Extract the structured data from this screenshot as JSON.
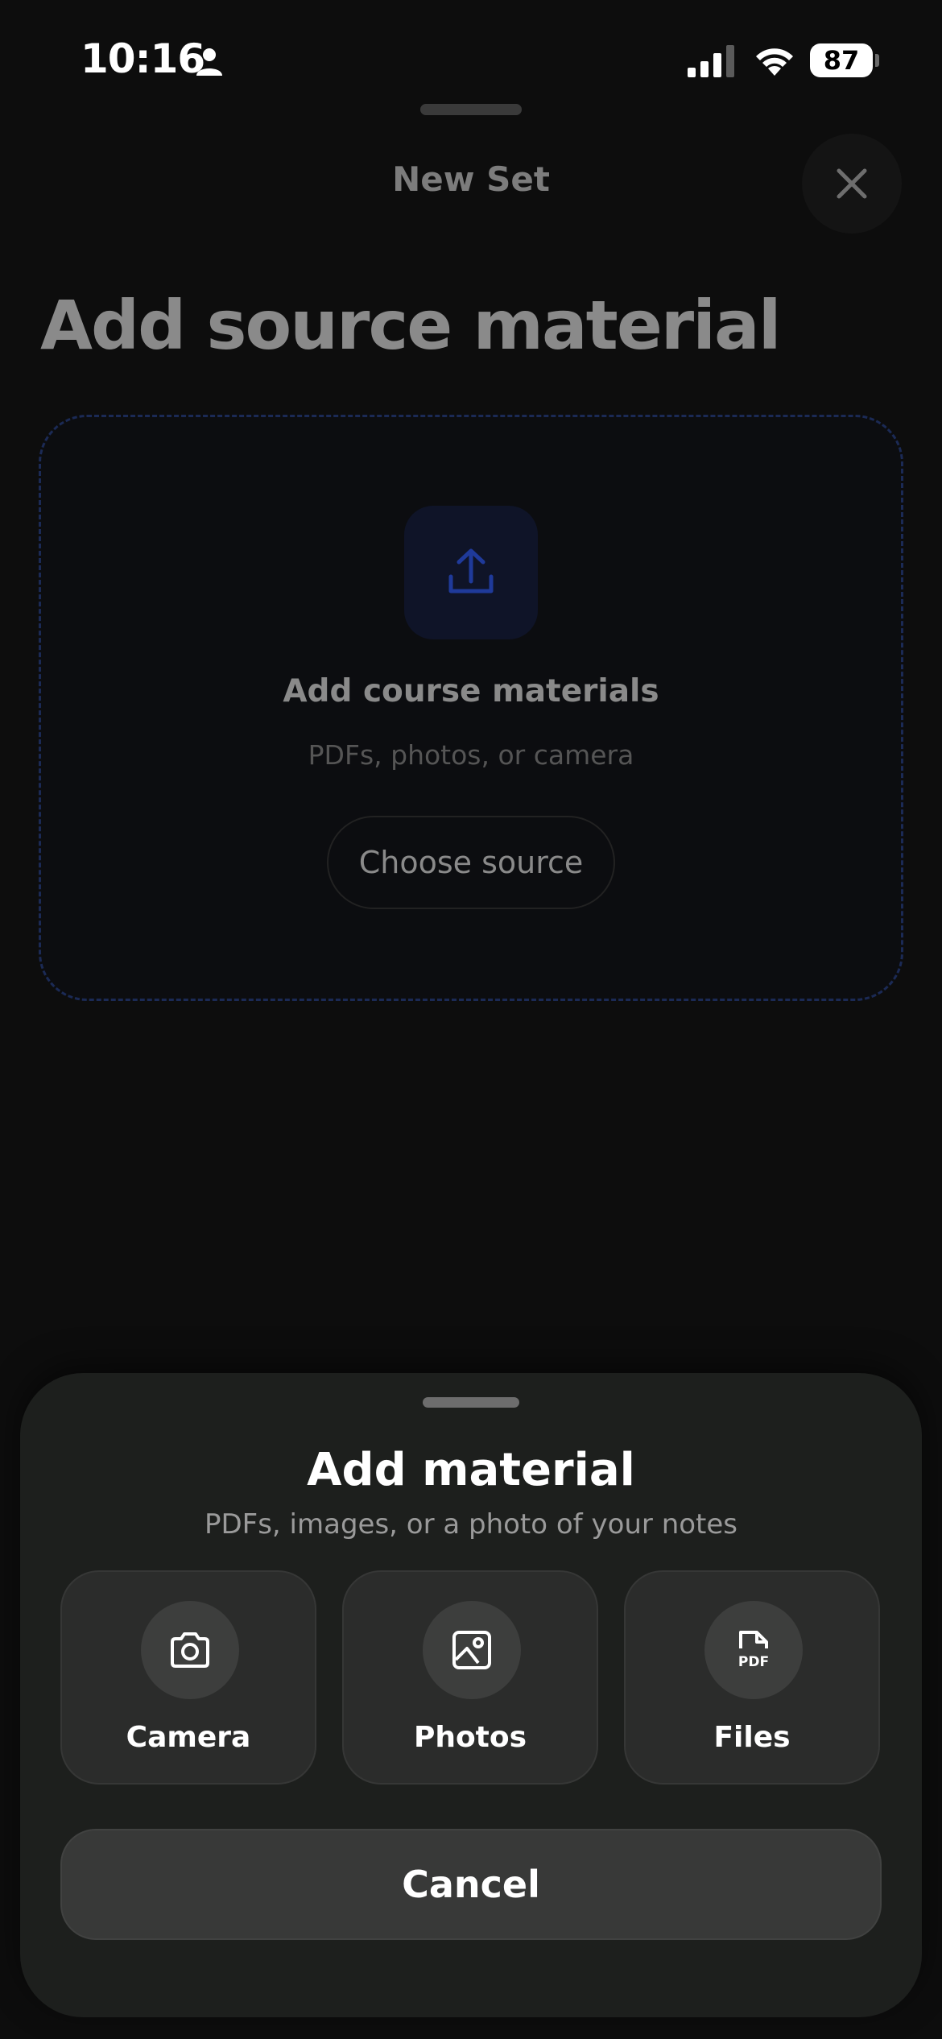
{
  "status_bar": {
    "time": "10:16",
    "battery": "87"
  },
  "background": {
    "header_title": "New Set",
    "heading": "Add source material",
    "dropzone": {
      "title": "Add course materials",
      "subtitle": "PDFs, photos, or camera",
      "choose_label": "Choose source"
    }
  },
  "sheet": {
    "title": "Add material",
    "subtitle": "PDFs, images, or a photo of your notes",
    "options": [
      {
        "label": "Camera",
        "icon": "camera-icon"
      },
      {
        "label": "Photos",
        "icon": "image-icon"
      },
      {
        "label": "Files",
        "icon": "pdf-file-icon"
      }
    ],
    "cancel_label": "Cancel"
  },
  "colors": {
    "accent_blue": "#1f3a9a",
    "sheet_bg": "#1d1f1d",
    "option_bg": "#2b2c2b"
  }
}
